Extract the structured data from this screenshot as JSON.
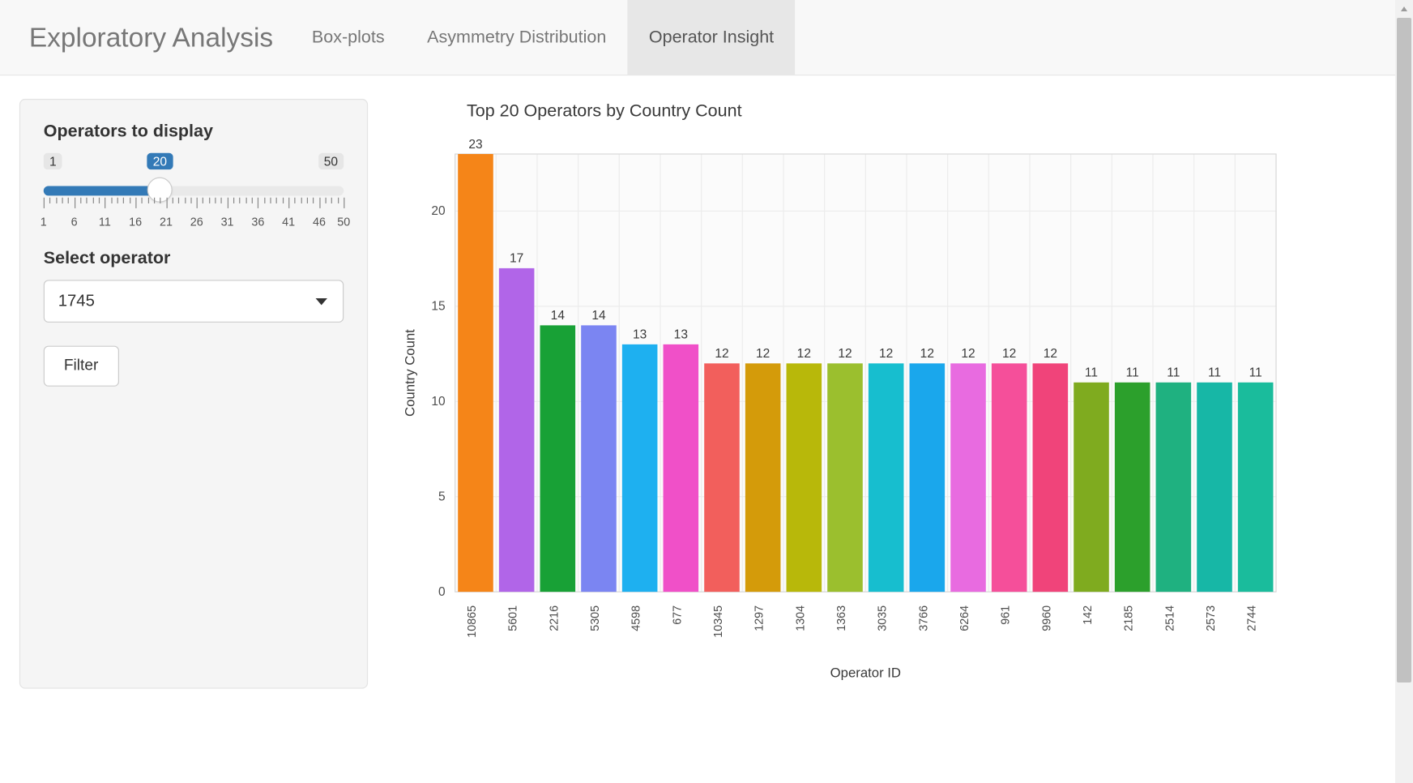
{
  "navbar": {
    "brand": "Exploratory Analysis",
    "tabs": [
      {
        "label": "Box-plots",
        "active": false
      },
      {
        "label": "Asymmetry Distribution",
        "active": false
      },
      {
        "label": "Operator Insight",
        "active": true
      }
    ]
  },
  "sidebar": {
    "operators_label": "Operators to display",
    "slider": {
      "min": 1,
      "max": 50,
      "value": 20,
      "major_ticks": [
        1,
        6,
        11,
        16,
        21,
        26,
        31,
        36,
        41,
        46,
        50
      ]
    },
    "select_label": "Select operator",
    "select_value": "1745",
    "filter_label": "Filter"
  },
  "chart_data": {
    "type": "bar",
    "title": "Top 20 Operators by Country Count",
    "xlabel": "Operator ID",
    "ylabel": "Country Count",
    "ylim": [
      0,
      23
    ],
    "yticks": [
      0,
      5,
      10,
      15,
      20
    ],
    "categories": [
      "10865",
      "5601",
      "2216",
      "5305",
      "4598",
      "677",
      "10345",
      "1297",
      "1304",
      "1363",
      "3035",
      "3766",
      "6264",
      "961",
      "9960",
      "142",
      "2185",
      "2514",
      "2573",
      "2744"
    ],
    "values": [
      23,
      17,
      14,
      14,
      13,
      13,
      12,
      12,
      12,
      12,
      12,
      12,
      12,
      12,
      12,
      11,
      11,
      11,
      11,
      11
    ],
    "colors": [
      "#f58518",
      "#b165e8",
      "#18a136",
      "#7b85f2",
      "#1eb0f0",
      "#f050c8",
      "#f25f5c",
      "#d49b0a",
      "#b8b80a",
      "#9bbf2e",
      "#17becf",
      "#1aa7ec",
      "#e86be0",
      "#f54f9a",
      "#f0447a",
      "#7fab1f",
      "#2ca02c",
      "#1fb180",
      "#17b7a6",
      "#1abc9c"
    ]
  }
}
